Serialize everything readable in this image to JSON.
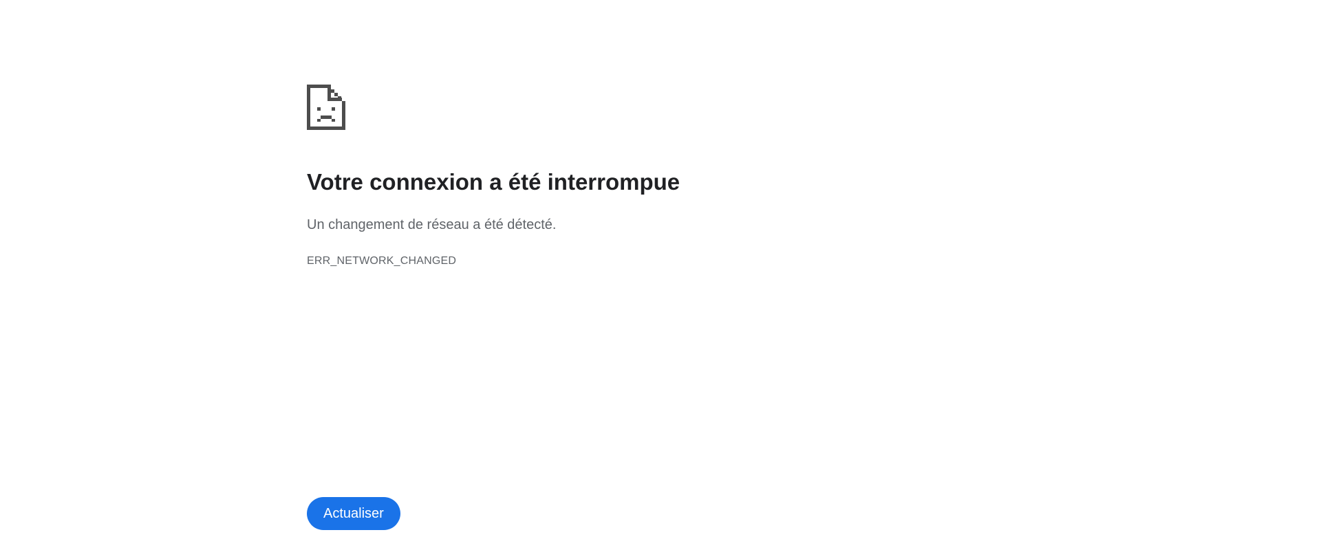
{
  "error_page": {
    "icon": "sad-document-icon",
    "title": "Votre connexion a été interrompue",
    "message": "Un changement de réseau a été détecté.",
    "error_code": "ERR_NETWORK_CHANGED",
    "reload_label": "Actualiser"
  },
  "colors": {
    "icon": "#4d4d4d",
    "title": "#202124",
    "text": "#5f6368",
    "button": "#1a73e8",
    "button_text": "#ffffff"
  }
}
